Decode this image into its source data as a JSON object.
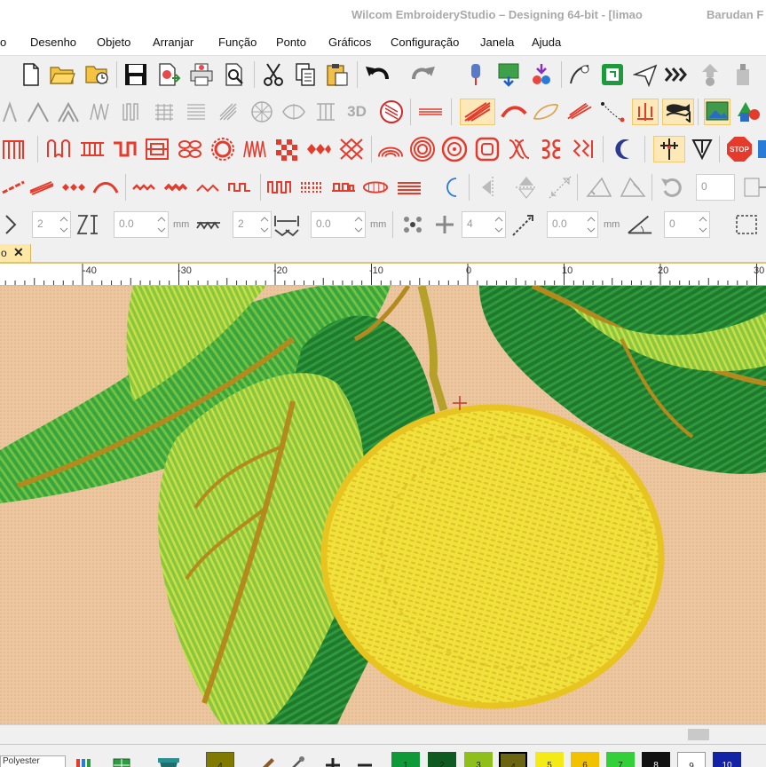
{
  "window": {
    "title": "Wilcom EmbroideryStudio – Designing 64-bit - [limao",
    "title_right": "Barudan F"
  },
  "menu": {
    "items": [
      "o",
      "Desenho",
      "Objeto",
      "Arranjar",
      "Função",
      "Ponto",
      "Gráficos",
      "Configuração",
      "Janela",
      "Ajuda"
    ]
  },
  "toolbar_values": {
    "rows_left": "2",
    "spacing_a": "0.0",
    "unit_a": "mm",
    "rows_right": "2",
    "spacing_b": "0.0",
    "unit_b": "mm",
    "count": "4",
    "offset_d": "0.0",
    "unit_c": "mm",
    "angle_a": "0",
    "tb4_value": "0",
    "label_3d": "3D",
    "stop_label": "STOP"
  },
  "doc_tab": {
    "label": "o",
    "close": "✕"
  },
  "ruler": {
    "labels": [
      "-40",
      "-30",
      "-20",
      "-10",
      "0",
      "10",
      "20",
      "30"
    ]
  },
  "bottom_bar": {
    "fabric": "Polyester",
    "swatches": [
      {
        "label": "4",
        "color": "#807a00"
      },
      {
        "label": "1",
        "color": "#0f9a3a"
      },
      {
        "label": "2",
        "color": "#0e5a20"
      },
      {
        "label": "3",
        "color": "#8fbf1a"
      },
      {
        "label": "4",
        "color": "#6b6410"
      },
      {
        "label": "5",
        "color": "#f4ea18"
      },
      {
        "label": "6",
        "color": "#f2c200"
      },
      {
        "label": "7",
        "color": "#34d03a"
      },
      {
        "label": "8",
        "color": "#111111"
      },
      {
        "label": "9",
        "color": "#ffffff"
      },
      {
        "label": "10",
        "color": "#1422a6"
      }
    ]
  },
  "colors": {
    "accent_red": "#e53b2c",
    "highlight": "#fde9b8",
    "canvas_fabric": "#ecc69f",
    "lemon": "#f2e13a",
    "leaf_dark": "#1f7a2e",
    "leaf_light": "#8cc63f"
  }
}
